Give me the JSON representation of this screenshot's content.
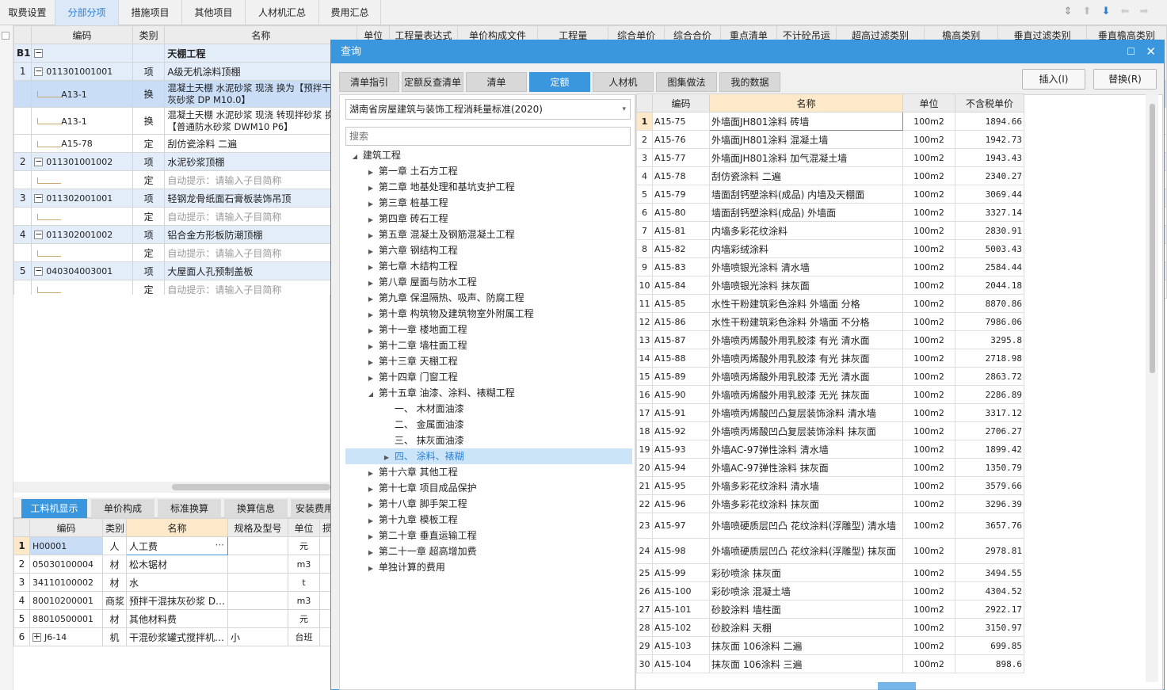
{
  "nav": {
    "tabs": [
      "取费设置",
      "分部分项",
      "措施项目",
      "其他项目",
      "人材机汇总",
      "费用汇总"
    ],
    "active": 1
  },
  "main_grid": {
    "headers": [
      "编码",
      "类别",
      "名称",
      "单位",
      "工程量表达式",
      "单价构成文件",
      "工程量",
      "综合单价",
      "综合合价",
      "重点清单",
      "不计砼吊运",
      "超高过滤类别",
      "檐高类别",
      "垂直过滤类别",
      "垂直檐高类别"
    ],
    "section": {
      "no": "B1",
      "name": "天棚工程"
    },
    "rows": [
      {
        "no": "1",
        "code": "011301001001",
        "type": "项",
        "name": "A级无机涂料顶棚",
        "kind": "item"
      },
      {
        "no": "",
        "code": "A13-1",
        "type": "换",
        "name": "混凝土天棚 水泥砂浆 现浇  换为【预拌干混抹灰砂浆 DP M10.0】",
        "kind": "sub-sel"
      },
      {
        "no": "",
        "code": "A13-1",
        "type": "换",
        "name": "混凝土天棚 水泥砂浆 现浇  转现拌砂浆 换为【普通防水砂浆 DWM10 P6】",
        "kind": "sub"
      },
      {
        "no": "",
        "code": "A15-78",
        "type": "定",
        "name": "刮仿瓷涂料 二遍",
        "kind": "sub"
      },
      {
        "no": "2",
        "code": "011301001002",
        "type": "项",
        "name": "水泥砂浆顶棚",
        "kind": "item"
      },
      {
        "no": "",
        "code": "",
        "type": "定",
        "name": "自动提示：请输入子目简称",
        "kind": "hint"
      },
      {
        "no": "3",
        "code": "011302001001",
        "type": "项",
        "name": "轻钢龙骨纸面石膏板装饰吊顶",
        "kind": "item"
      },
      {
        "no": "",
        "code": "",
        "type": "定",
        "name": "自动提示：请输入子目简称",
        "kind": "hint"
      },
      {
        "no": "4",
        "code": "011302001002",
        "type": "项",
        "name": "铝合金方形板防潮顶棚",
        "kind": "item"
      },
      {
        "no": "",
        "code": "",
        "type": "定",
        "name": "自动提示：请输入子目简称",
        "kind": "hint"
      },
      {
        "no": "5",
        "code": "040304003001",
        "type": "项",
        "name": "大屋面人孔预制盖板",
        "kind": "item"
      },
      {
        "no": "",
        "code": "",
        "type": "定",
        "name": "自动提示：请输入子目简称",
        "kind": "hint"
      }
    ]
  },
  "bottom_tabs": [
    "工料机显示",
    "单价构成",
    "标准换算",
    "换算信息",
    "安装费用"
  ],
  "bottom_grid": {
    "headers": [
      "编码",
      "类别",
      "名称",
      "规格及型号",
      "单位",
      "损"
    ],
    "rows": [
      {
        "no": "1",
        "code": "H00001",
        "type": "人",
        "name": "人工费",
        "spec": "",
        "unit": "元"
      },
      {
        "no": "2",
        "code": "05030100004",
        "type": "材",
        "name": "松木锯材",
        "spec": "",
        "unit": "m3"
      },
      {
        "no": "3",
        "code": "34110100002",
        "type": "材",
        "name": "水",
        "spec": "",
        "unit": "t"
      },
      {
        "no": "4",
        "code": "80010200001",
        "type": "商浆",
        "name": "预拌干混抹灰砂浆 D…",
        "spec": "",
        "unit": "m3"
      },
      {
        "no": "5",
        "code": "88010500001",
        "type": "材",
        "name": "其他材料费",
        "spec": "",
        "unit": "元"
      },
      {
        "no": "6",
        "code": "J6-14",
        "type": "机",
        "name": "干混砂浆罐式搅拌机…",
        "spec": "小",
        "unit": "台班"
      }
    ]
  },
  "dialog": {
    "title": "查询",
    "tabs": [
      "清单指引",
      "定额反查清单",
      "清单",
      "定额",
      "人材机",
      "图集做法",
      "我的数据"
    ],
    "active_tab": 3,
    "insert_label": "插入(I)",
    "replace_label": "替换(R)",
    "standard": "湖南省房屋建筑与装饰工程消耗量标准(2020)",
    "search_placeholder": "搜索",
    "tree": [
      {
        "label": "建筑工程",
        "level": 0,
        "arrow": "down"
      },
      {
        "label": "第一章 土石方工程",
        "level": 1,
        "arrow": "right"
      },
      {
        "label": "第二章 地基处理和基坑支护工程",
        "level": 1,
        "arrow": "right"
      },
      {
        "label": "第三章 桩基工程",
        "level": 1,
        "arrow": "right"
      },
      {
        "label": "第四章 砖石工程",
        "level": 1,
        "arrow": "right"
      },
      {
        "label": "第五章 混凝土及钢筋混凝土工程",
        "level": 1,
        "arrow": "right"
      },
      {
        "label": "第六章 钢结构工程",
        "level": 1,
        "arrow": "right"
      },
      {
        "label": "第七章 木结构工程",
        "level": 1,
        "arrow": "right"
      },
      {
        "label": "第八章 屋面与防水工程",
        "level": 1,
        "arrow": "right"
      },
      {
        "label": "第九章 保温隔热、吸声、防腐工程",
        "level": 1,
        "arrow": "right"
      },
      {
        "label": "第十章 构筑物及建筑物室外附属工程",
        "level": 1,
        "arrow": "right"
      },
      {
        "label": "第十一章 楼地面工程",
        "level": 1,
        "arrow": "right"
      },
      {
        "label": "第十二章 墙柱面工程",
        "level": 1,
        "arrow": "right"
      },
      {
        "label": "第十三章 天棚工程",
        "level": 1,
        "arrow": "right"
      },
      {
        "label": "第十四章 门窗工程",
        "level": 1,
        "arrow": "right"
      },
      {
        "label": "第十五章 油漆、涂料、裱糊工程",
        "level": 1,
        "arrow": "down"
      },
      {
        "label": "一、 木材面油漆",
        "level": 2,
        "arrow": ""
      },
      {
        "label": "二、 金属面油漆",
        "level": 2,
        "arrow": ""
      },
      {
        "label": "三、 抹灰面油漆",
        "level": 2,
        "arrow": ""
      },
      {
        "label": "四、 涂料、裱糊",
        "level": 2,
        "arrow": "right",
        "selected": true
      },
      {
        "label": "第十六章 其他工程",
        "level": 1,
        "arrow": "right"
      },
      {
        "label": "第十七章 项目成品保护",
        "level": 1,
        "arrow": "right"
      },
      {
        "label": "第十八章 脚手架工程",
        "level": 1,
        "arrow": "right"
      },
      {
        "label": "第十九章 模板工程",
        "level": 1,
        "arrow": "right"
      },
      {
        "label": "第二十章 垂直运输工程",
        "level": 1,
        "arrow": "right"
      },
      {
        "label": "第二十一章 超高增加费",
        "level": 1,
        "arrow": "right"
      },
      {
        "label": "单独计算的费用",
        "level": 1,
        "arrow": "right"
      }
    ],
    "result_headers": [
      "编码",
      "名称",
      "单位",
      "不含税单价"
    ],
    "results": [
      {
        "no": "1",
        "code": "A15-75",
        "name": "外墙面JH801涂料 砖墙",
        "unit": "100m2",
        "price": "1894.66"
      },
      {
        "no": "2",
        "code": "A15-76",
        "name": "外墙面JH801涂料 混凝土墙",
        "unit": "100m2",
        "price": "1942.73"
      },
      {
        "no": "3",
        "code": "A15-77",
        "name": "外墙面JH801涂料 加气混凝土墙",
        "unit": "100m2",
        "price": "1943.43"
      },
      {
        "no": "4",
        "code": "A15-78",
        "name": "刮仿瓷涂料 二遍",
        "unit": "100m2",
        "price": "2340.27"
      },
      {
        "no": "5",
        "code": "A15-79",
        "name": "墙面刮钙塑涂料(成品) 内墙及天棚面",
        "unit": "100m2",
        "price": "3069.44"
      },
      {
        "no": "6",
        "code": "A15-80",
        "name": "墙面刮钙塑涂料(成品) 外墙面",
        "unit": "100m2",
        "price": "3327.14"
      },
      {
        "no": "7",
        "code": "A15-81",
        "name": "内墙多彩花纹涂料",
        "unit": "100m2",
        "price": "2830.91"
      },
      {
        "no": "8",
        "code": "A15-82",
        "name": "内墙彩绒涂料",
        "unit": "100m2",
        "price": "5003.43"
      },
      {
        "no": "9",
        "code": "A15-83",
        "name": "外墙喷银光涂料 清水墙",
        "unit": "100m2",
        "price": "2584.44"
      },
      {
        "no": "10",
        "code": "A15-84",
        "name": "外墙喷银光涂料 抹灰面",
        "unit": "100m2",
        "price": "2044.18"
      },
      {
        "no": "11",
        "code": "A15-85",
        "name": "水性干粉建筑彩色涂料 外墙面 分格",
        "unit": "100m2",
        "price": "8870.86"
      },
      {
        "no": "12",
        "code": "A15-86",
        "name": "水性干粉建筑彩色涂料 外墙面 不分格",
        "unit": "100m2",
        "price": "7986.06"
      },
      {
        "no": "13",
        "code": "A15-87",
        "name": "外墙喷丙烯酸外用乳胶漆 有光 清水面",
        "unit": "100m2",
        "price": "3295.8"
      },
      {
        "no": "14",
        "code": "A15-88",
        "name": "外墙喷丙烯酸外用乳胶漆 有光 抹灰面",
        "unit": "100m2",
        "price": "2718.98"
      },
      {
        "no": "15",
        "code": "A15-89",
        "name": "外墙喷丙烯酸外用乳胶漆 无光 清水面",
        "unit": "100m2",
        "price": "2863.72"
      },
      {
        "no": "16",
        "code": "A15-90",
        "name": "外墙喷丙烯酸外用乳胶漆 无光 抹灰面",
        "unit": "100m2",
        "price": "2286.89"
      },
      {
        "no": "17",
        "code": "A15-91",
        "name": "外墙喷丙烯酸凹凸复层装饰涂料 清水墙",
        "unit": "100m2",
        "price": "3317.12"
      },
      {
        "no": "18",
        "code": "A15-92",
        "name": "外墙喷丙烯酸凹凸复层装饰涂料 抹灰面",
        "unit": "100m2",
        "price": "2706.27"
      },
      {
        "no": "19",
        "code": "A15-93",
        "name": "外墙AC-97弹性涂料 清水墙",
        "unit": "100m2",
        "price": "1899.42"
      },
      {
        "no": "20",
        "code": "A15-94",
        "name": "外墙AC-97弹性涂料 抹灰面",
        "unit": "100m2",
        "price": "1350.79"
      },
      {
        "no": "21",
        "code": "A15-95",
        "name": "外墙多彩花纹涂料 清水墙",
        "unit": "100m2",
        "price": "3579.66"
      },
      {
        "no": "22",
        "code": "A15-96",
        "name": "外墙多彩花纹涂料 抹灰面",
        "unit": "100m2",
        "price": "3296.39"
      },
      {
        "no": "23",
        "code": "A15-97",
        "name": "外墙喷硬质层凹凸 花纹涂料(浮雕型) 清水墙",
        "unit": "100m2",
        "price": "3657.76"
      },
      {
        "no": "24",
        "code": "A15-98",
        "name": "外墙喷硬质层凹凸 花纹涂料(浮雕型) 抹灰面",
        "unit": "100m2",
        "price": "2978.81"
      },
      {
        "no": "25",
        "code": "A15-99",
        "name": "彩砂喷涂 抹灰面",
        "unit": "100m2",
        "price": "3494.55"
      },
      {
        "no": "26",
        "code": "A15-100",
        "name": "彩砂喷涂 混凝土墙",
        "unit": "100m2",
        "price": "4304.52"
      },
      {
        "no": "27",
        "code": "A15-101",
        "name": "砂胶涂料 墙柱面",
        "unit": "100m2",
        "price": "2922.17"
      },
      {
        "no": "28",
        "code": "A15-102",
        "name": "砂胶涂料 天棚",
        "unit": "100m2",
        "price": "3150.97"
      },
      {
        "no": "29",
        "code": "A15-103",
        "name": "抹灰面 106涂料 二遍",
        "unit": "100m2",
        "price": "699.85"
      },
      {
        "no": "30",
        "code": "A15-104",
        "name": "抹灰面 106涂料 三遍",
        "unit": "100m2",
        "price": "898.6"
      }
    ]
  },
  "colors": {
    "accent": "#3a96dd",
    "row_highlight": "#e3ecf9",
    "row_selected": "#c9ddf7"
  }
}
